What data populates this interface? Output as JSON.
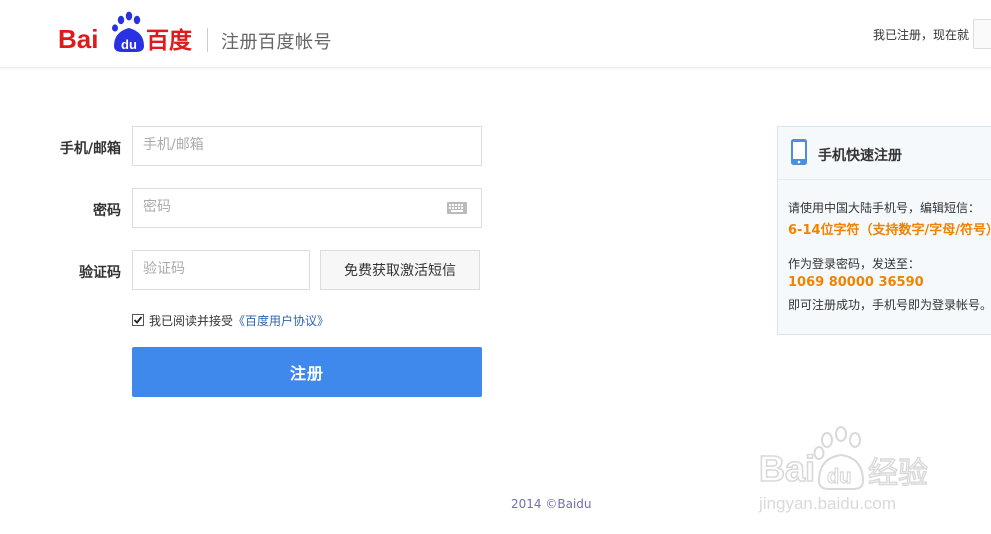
{
  "header": {
    "logo_alt": "Baidu百度",
    "title": "注册百度帐号",
    "login_prompt": "我已注册，现在就"
  },
  "form": {
    "phone_email": {
      "label": "手机/邮箱",
      "placeholder": "手机/邮箱"
    },
    "password": {
      "label": "密码",
      "placeholder": "密码"
    },
    "captcha": {
      "label": "验证码",
      "placeholder": "验证码",
      "sms_button": "免费获取激活短信"
    },
    "agreement": {
      "text": "我已阅读并接受",
      "link": "《百度用户协议》",
      "checked": true
    },
    "submit": "注册"
  },
  "panel": {
    "title": "手机快速注册",
    "line1": "请使用中国大陆手机号，编辑短信：",
    "highlight1": "6-14位字符（支持数字/字母/符号）",
    "line2": "作为登录密码，发送至：",
    "highlight2": "1069 80000 36590",
    "line3": "即可注册成功，手机号即为登录帐号。"
  },
  "footer": {
    "copyright": "2014 ©Baidu"
  },
  "watermark": {
    "text": "Baidu经验",
    "url": "jingyan.baidu.com"
  },
  "colors": {
    "brand_red": "#de1a1a",
    "brand_blue": "#2932e1",
    "submit_blue": "#3f89ec",
    "highlight_orange": "#f08300",
    "link_blue": "#2d64b3"
  }
}
